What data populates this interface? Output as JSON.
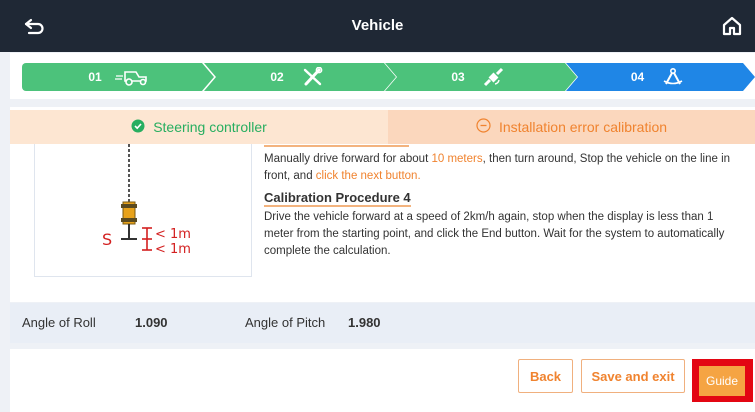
{
  "header": {
    "title": "Vehicle",
    "back_icon": "back-arrow-icon",
    "home_icon": "home-icon"
  },
  "stepper": {
    "steps": [
      {
        "number": "01",
        "icon": "tractor-icon",
        "state": "done",
        "color": "#4cc27b"
      },
      {
        "number": "02",
        "icon": "tools-icon",
        "state": "done",
        "color": "#4cc27b"
      },
      {
        "number": "03",
        "icon": "satellite-icon",
        "state": "done",
        "color": "#4cc27b"
      },
      {
        "number": "04",
        "icon": "compass-icon",
        "state": "active",
        "color": "#1f86e6"
      }
    ]
  },
  "tabs": {
    "left": {
      "label": "Steering controller",
      "icon": "check-circle-icon"
    },
    "right": {
      "label": "Installation error calibration",
      "icon": "minus-circle-icon"
    }
  },
  "illustration": {
    "letter": "S",
    "label_top": "< 1m",
    "label_bottom": "< 1m"
  },
  "content": {
    "step3_text_1": "Manually drive forward for about ",
    "step3_highlight_1": "10 meters",
    "step3_text_2": ", then turn around, Stop the vehicle on the line in front, and ",
    "step3_highlight_2": "click the next button.",
    "procedure4_title": "Calibration Procedure 4",
    "procedure4_text": "Drive the vehicle forward at a speed of 2km/h again, stop when the display is less than 1 meter from the starting point, and click the End button. Wait for the system to automatically complete the calculation."
  },
  "angles": {
    "roll_label": "Angle of Roll",
    "roll_value": "1.090",
    "pitch_label": "Angle of Pitch",
    "pitch_value": "1.980"
  },
  "buttons": {
    "back": "Back",
    "save_exit": "Save and exit",
    "guide": "Guide"
  },
  "colors": {
    "header_bg": "#1f2835",
    "accent_orange": "#f0832f",
    "success_green": "#27ae60",
    "highlight_red": "#e30613"
  }
}
